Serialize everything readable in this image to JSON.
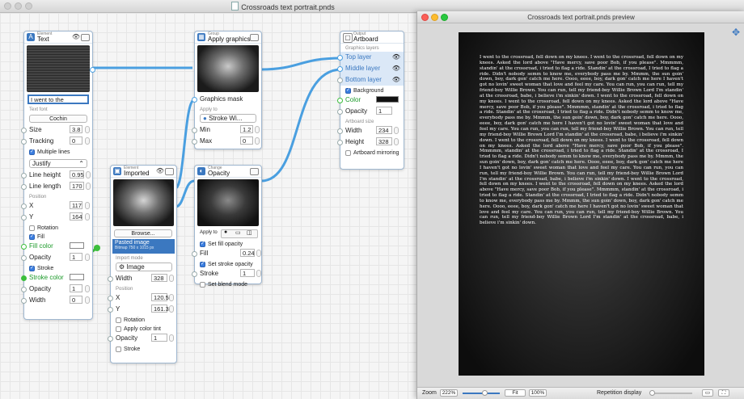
{
  "main_window": {
    "title": "Crossroads text portrait.pnds"
  },
  "text_node": {
    "subtitle": "Element",
    "title": "Text",
    "text_value": "I went to the",
    "font_section": "Text font",
    "font_name": "Cochin",
    "size_label": "Size",
    "size_value": "3.8",
    "tracking_label": "Tracking",
    "tracking_value": "0",
    "multiple_lines_label": "Multiple lines",
    "justify_value": "Justify",
    "line_height_label": "Line height",
    "line_height_value": "0.95",
    "line_length_label": "Line length",
    "line_length_value": "170",
    "position_section": "Position",
    "x_label": "X",
    "x_value": "117",
    "y_label": "Y",
    "y_value": "164",
    "rotation_label": "Rotation",
    "fill_label": "Fill",
    "fill_color_label": "Fill color",
    "opacity_label": "Opacity",
    "opacity_value": "1",
    "stroke_label": "Stroke",
    "stroke_color_label": "Stroke color",
    "opacity2_label": "Opacity",
    "opacity2_value": "1",
    "width_label": "Width",
    "width_value": "0"
  },
  "apply_node": {
    "subtitle": "Group",
    "title": "Apply graphics",
    "mask_label": "Graphics mask",
    "apply_to_section": "Apply to",
    "apply_to_value": "Stroke Wi...",
    "min_label": "Min",
    "min_value": "1.2",
    "max_label": "Max",
    "max_value": "0"
  },
  "imported_node": {
    "subtitle": "Element",
    "title": "Imported",
    "browse_label": "Browse...",
    "pasted_title": "Pasted image",
    "pasted_info": "Bitmap 750 x 1015 px",
    "import_mode_section": "Import mode",
    "mode_value": "Image",
    "width_label": "Width",
    "width_value": "328",
    "position_section": "Position",
    "x_label": "X",
    "x_value": "120.5",
    "y_label": "Y",
    "y_value": "161.3",
    "rotation_label": "Rotation",
    "tint_label": "Apply color tint",
    "opacity_label": "Opacity",
    "opacity_value": "1",
    "stroke_label": "Stroke"
  },
  "opacity_node": {
    "subtitle": "Change",
    "title": "Opacity",
    "apply_to_label": "Apply to",
    "set_fill_label": "Set fill opacity",
    "fill_label": "Fill",
    "fill_value": "0.24",
    "set_stroke_label": "Set stroke opacity",
    "stroke_label": "Stroke",
    "stroke_value": "1",
    "blend_label": "Set blend mode"
  },
  "artboard_node": {
    "subtitle": "Output",
    "title": "Artboard",
    "layers_section": "Graphics layers",
    "top_layer": "Top layer",
    "middle_layer": "Middle layer",
    "bottom_layer": "Bottom layer",
    "background_label": "Background",
    "color_label": "Color",
    "opacity_label": "Opacity",
    "opacity_value": "1",
    "size_section": "Artboard size",
    "width_label": "Width",
    "width_value": "234",
    "height_label": "Height",
    "height_value": "328",
    "mirroring_label": "Artboard mirroring"
  },
  "preview_window": {
    "title": "Crossroads text portrait.pnds preview",
    "zoom_label": "Zoom",
    "zoom_value": "222%",
    "fit_label": "Fit",
    "hundred_label": "100%",
    "repetition_label": "Repetition display"
  },
  "preview_text": "I went to the crossroad, fell down on my knees. I went to the crossroad, fell down on my knees. Asked the lord above \"Have mercy, save poor Bob, if you please\". Mmmmm, standin' at the crossroad, i tried to flag a ride. Standin' at the crossroad, I tried to flag a ride. Didn't nobody semm to know me, everybody pass me by. Mmmm, the sun goin' down, boy, dark gon' catch me here. Oooo, eeee, boy, dark gon' catch me here I haven't got no lovin' sweet woman that love and feel my care. You can run, you can run, tell my friend-boy Willie Brown. You can run, tell my friend-boy Willie Brown Lord I'm standin' at the crossroad, babe, i believe i'm sinkin' down. I went to the crossroad, fell down on my knees. I went to the crossroad, fell down on my knees. Asked the lord above \"Have mercy, save poor Bob, if you please\". Mmmmm, standin' at the crossroad, i tried to flag a ride. Standin' at the crossroad, I tried to flag a ride. Didn't nobody semm to know me, everybody pass me by. Mmmm, the sun goin' down, boy, dark gon' catch me here. Oooo, eeee, boy, dark gon' catch me here I haven't got no lovin' sweet woman that love and feel my care. You can run, you can run, tell my friend-boy Willie Brown. You can run, tell my friend-boy Willie Brown Lord I'm standin' at the crossroad, babe, i believe i'm sinkin' down. I went to the crossroad, fell down on my knees. I went to the crossroad, fell down on my knees. Asked the lord above \"Have mercy, save poor Bob, if you please\". Mmmmm, standin' at the crossroad, i tried to flag a ride. Standin' at the crossroad, I tried to flag a ride. Didn't nobody semm to know me, everybody pass me by. Mmmm, the sun goin' down, boy, dark gon' catch me here. Oooo, eeee, boy, dark gon' catch me here I haven't got no lovin' sweet woman that love and feel my care. You can run, you can run, tell my friend-boy Willie Brown. You can run, tell my friend-boy Willie Brown Lord I'm standin' at the crossroad, babe, i believe i'm sinkin' down. I went to the crossroad, fell down on my knees. I went to the crossroad, fell down on my knees. Asked the lord above \"Have mercy, save poor Bob, if you please\". Mmmmm, standin' at the crossroad, i tried to flag a ride. Standin' at the crossroad, I tried to flag a ride. Didn't nobody semm to know me, everybody pass me by. Mmmm, the sun goin' down, boy, dark gon' catch me here. Oooo, eeee, boy, dark gon' catch me here I haven't got no lovin' sweet woman that love and feel my care. You can run, you can run, tell my friend-boy Willie Brown. You can run, tell my friend-boy Willie Brown Lord I'm standin' at the crossroad, babe, i believe i'm sinkin' down.",
  "colors": {
    "accent": "#3b78c0",
    "wire": "#4a9fe0",
    "green_wire": "#3cbf3c"
  }
}
